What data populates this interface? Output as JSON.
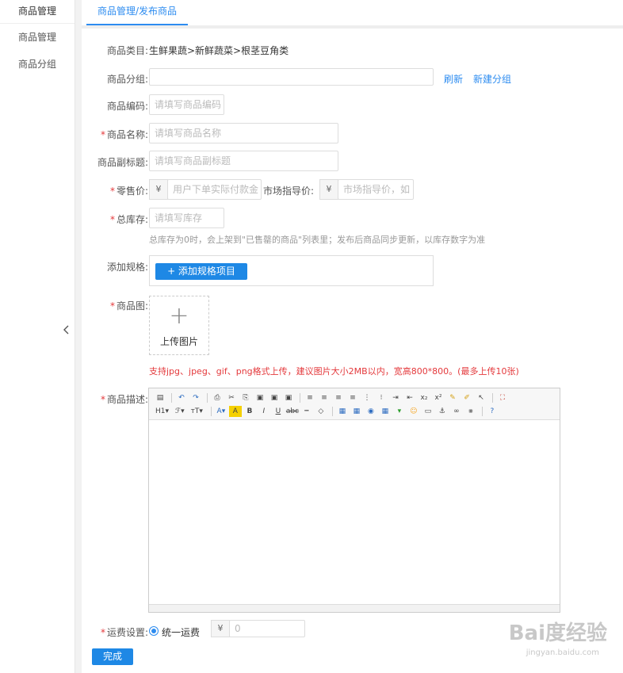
{
  "sidebar": {
    "title": "商品管理",
    "items": [
      {
        "label": "商品管理"
      },
      {
        "label": "商品分组"
      }
    ],
    "collapse_icon": "chevron-left"
  },
  "tab": {
    "label": "商品管理/发布商品"
  },
  "form": {
    "category": {
      "label": "商品类目:",
      "value": "生鲜果蔬>新鲜蔬菜>根茎豆角类"
    },
    "group": {
      "label": "商品分组:",
      "value": "",
      "refresh": "刷新",
      "new_group": "新建分组"
    },
    "code": {
      "label": "商品编码:",
      "placeholder": "请填写商品编码"
    },
    "name": {
      "label": "商品名称:",
      "placeholder": "请填写商品名称",
      "required": "*"
    },
    "subtitle": {
      "label": "商品副标题:",
      "placeholder": "请填写商品副标题"
    },
    "price": {
      "label": "零售价:",
      "currency": "¥",
      "placeholder": "用户下单实际付款金",
      "required": "*",
      "market_label": "市场指导价:",
      "market_currency": "¥",
      "market_placeholder": "市场指导价，如"
    },
    "stock": {
      "label": "总库存:",
      "placeholder": "请填写库存",
      "required": "*",
      "hint": "总库存为0时，会上架到\"已售罄的商品\"列表里；发布后商品同步更新，以库存数字为准"
    },
    "spec": {
      "label": "添加规格:",
      "button": "+  添加规格项目"
    },
    "image": {
      "label": "商品图:",
      "required": "*",
      "upload_plus": "+",
      "upload_text": "上传图片",
      "hint": "支持jpg、jpeg、gif、png格式上传，建议图片大小2MB以内，宽高800*800。(最多上传10张)"
    },
    "description": {
      "label": "商品描述:",
      "required": "*"
    },
    "shipping": {
      "label": "运费设置:",
      "required": "*",
      "option": "统一运费",
      "currency": "¥",
      "value": "0"
    },
    "submit": "完成"
  },
  "editor_toolbar": {
    "row1": [
      "source",
      "undo",
      "redo",
      "preview",
      "cut",
      "copy",
      "paste",
      "paste-text",
      "paste-word",
      "align-left",
      "align-center",
      "align-right",
      "justify",
      "ordered-list",
      "bullet-list",
      "indent",
      "outdent",
      "subscript",
      "superscript",
      "clear-format",
      "quick-format",
      "select-all",
      "fullscreen"
    ],
    "row2": [
      "heading",
      "font-family",
      "font-size",
      "font-color",
      "highlight",
      "bold",
      "italic",
      "underline",
      "strikethrough",
      "hr",
      "remove-format",
      "image",
      "multi-image",
      "flash",
      "table",
      "insert-code",
      "emoticon",
      "page-break",
      "anchor",
      "link",
      "unlink",
      "help"
    ],
    "row2_labels": {
      "heading": "H1▾",
      "font_family": "ℱ▾",
      "font_size": "тT▾"
    }
  },
  "watermark": {
    "text": "Bai度经验",
    "url": "jingyan.baidu.com"
  },
  "colors": {
    "accent": "#2d8cf0",
    "button": "#1e88e5",
    "required": "#e4393c"
  }
}
